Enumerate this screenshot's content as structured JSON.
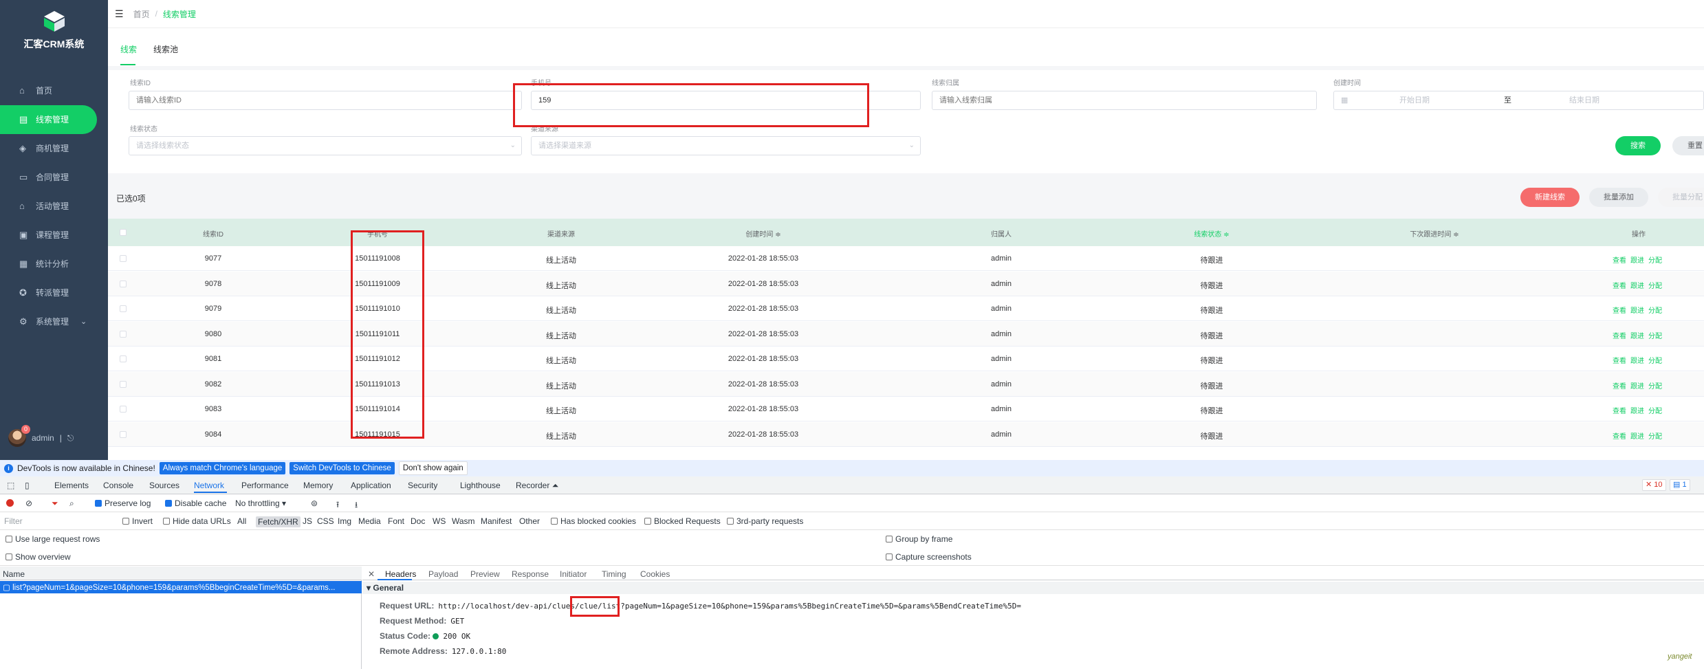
{
  "app": {
    "title": "汇客CRM系统"
  },
  "sidebar": {
    "items": [
      {
        "label": "首页",
        "icon": "home-icon"
      },
      {
        "label": "线索管理",
        "icon": "clue-icon",
        "active": true
      },
      {
        "label": "商机管理",
        "icon": "opportunity-icon"
      },
      {
        "label": "合同管理",
        "icon": "contract-icon"
      },
      {
        "label": "活动管理",
        "icon": "activity-icon"
      },
      {
        "label": "课程管理",
        "icon": "course-icon"
      },
      {
        "label": "统计分析",
        "icon": "chart-icon"
      },
      {
        "label": "转派管理",
        "icon": "transfer-icon"
      },
      {
        "label": "系统管理",
        "icon": "system-icon"
      }
    ],
    "user": {
      "name": "admin",
      "badge": "0"
    }
  },
  "breadcrumb": {
    "home": "首页",
    "current": "线索管理"
  },
  "tabs": [
    "线索",
    "线索池"
  ],
  "filters": {
    "clue_id": {
      "label": "线索ID",
      "placeholder": "请输入线索ID"
    },
    "phone": {
      "label": "手机号",
      "value": "159"
    },
    "owner": {
      "label": "线索归属",
      "placeholder": "请输入线索归属"
    },
    "create_time": {
      "label": "创建时间",
      "start": "开始日期",
      "sep": "至",
      "end": "结束日期"
    },
    "status": {
      "label": "线索状态",
      "placeholder": "请选择线索状态"
    },
    "channel": {
      "label": "渠道来源",
      "placeholder": "请选择渠道来源"
    },
    "search_btn": "搜索",
    "reset_btn": "重置"
  },
  "toolbar": {
    "selected": "已选0项",
    "new_btn": "新建线索",
    "batch_add": "批量添加",
    "batch_assign": "批量分配"
  },
  "table": {
    "headers": {
      "id": "线索ID",
      "phone": "手机号",
      "channel": "渠道来源",
      "created": "创建时间 ≑",
      "owner": "归属人",
      "status": "线索状态 ≑",
      "next": "下次跟进时间 ≑",
      "ops": "操作"
    },
    "op_labels": {
      "view": "查看",
      "follow": "跟进",
      "assign": "分配"
    },
    "rows": [
      {
        "id": "9077",
        "phone": "15011191008",
        "channel": "线上活动",
        "created": "2022-01-28 18:55:03",
        "owner": "admin",
        "status": "待跟进"
      },
      {
        "id": "9078",
        "phone": "15011191009",
        "channel": "线上活动",
        "created": "2022-01-28 18:55:03",
        "owner": "admin",
        "status": "待跟进"
      },
      {
        "id": "9079",
        "phone": "15011191010",
        "channel": "线上活动",
        "created": "2022-01-28 18:55:03",
        "owner": "admin",
        "status": "待跟进"
      },
      {
        "id": "9080",
        "phone": "15011191011",
        "channel": "线上活动",
        "created": "2022-01-28 18:55:03",
        "owner": "admin",
        "status": "待跟进"
      },
      {
        "id": "9081",
        "phone": "15011191012",
        "channel": "线上活动",
        "created": "2022-01-28 18:55:03",
        "owner": "admin",
        "status": "待跟进"
      },
      {
        "id": "9082",
        "phone": "15011191013",
        "channel": "线上活动",
        "created": "2022-01-28 18:55:03",
        "owner": "admin",
        "status": "待跟进"
      },
      {
        "id": "9083",
        "phone": "15011191014",
        "channel": "线上活动",
        "created": "2022-01-28 18:55:03",
        "owner": "admin",
        "status": "待跟进"
      },
      {
        "id": "9084",
        "phone": "15011191015",
        "channel": "线上活动",
        "created": "2022-01-28 18:55:03",
        "owner": "admin",
        "status": "待跟进"
      }
    ]
  },
  "devtools": {
    "infobar": {
      "text": "DevTools is now available in Chinese!",
      "btn1": "Always match Chrome's language",
      "btn2": "Switch DevTools to Chinese",
      "btn3": "Don't show again"
    },
    "tabs": [
      "Elements",
      "Console",
      "Sources",
      "Network",
      "Performance",
      "Memory",
      "Application",
      "Security",
      "Lighthouse",
      "Recorder ⏶"
    ],
    "errors": "10",
    "messages": "1",
    "toolbar": {
      "preserve": "Preserve log",
      "disable_cache": "Disable cache",
      "throttle": "No throttling"
    },
    "filter_row": {
      "placeholder": "Filter",
      "invert": "Invert",
      "hide_data": "Hide data URLs",
      "types": [
        "All",
        "Fetch/XHR",
        "JS",
        "CSS",
        "Img",
        "Media",
        "Font",
        "Doc",
        "WS",
        "Wasm",
        "Manifest",
        "Other"
      ],
      "blocked_cookies": "Has blocked cookies",
      "blocked_req": "Blocked Requests",
      "third_party": "3rd-party requests"
    },
    "options": {
      "large_rows": "Use large request rows",
      "overview": "Show overview",
      "group_frame": "Group by frame",
      "capture": "Capture screenshots"
    },
    "list": {
      "header": "Name",
      "item": "list?pageNum=1&pageSize=10&phone=159&params%5BbeginCreateTime%5D=&params..."
    },
    "detail": {
      "tabs": [
        "Headers",
        "Payload",
        "Preview",
        "Response",
        "Initiator",
        "Timing",
        "Cookies"
      ],
      "section": "▾ General",
      "url_label": "Request URL:",
      "url": "http://localhost/dev-api/clues/clue/list?pageNum=1&pageSize=10&phone=159&params%5BbeginCreateTime%5D=&params%5BendCreateTime%5D=",
      "method_label": "Request Method:",
      "method": "GET",
      "status_label": "Status Code:",
      "status": "200 OK",
      "remote_label": "Remote Address:",
      "remote": "127.0.0.1:80"
    },
    "watermark": "yangeit"
  },
  "colors": {
    "accent": "#13ce66",
    "sidebar": "#304156",
    "danger": "#f56c6c",
    "devtools_blue": "#1a73e8"
  }
}
